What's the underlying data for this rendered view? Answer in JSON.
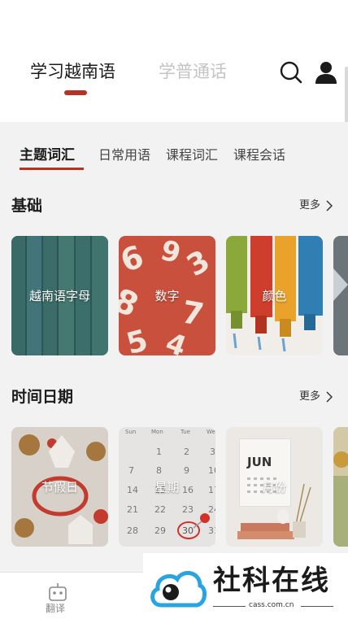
{
  "header": {
    "tabs": [
      {
        "label": "学习越南语",
        "active": true
      },
      {
        "label": "学普通话",
        "active": false
      }
    ],
    "icons": [
      "search-icon",
      "user-icon"
    ],
    "accent_color": "#b8321f"
  },
  "sub_tabs": [
    {
      "label": "主题词汇",
      "active": true
    },
    {
      "label": "日常用语",
      "active": false
    },
    {
      "label": "课程词汇",
      "active": false
    },
    {
      "label": "课程会话",
      "active": false
    }
  ],
  "sections": [
    {
      "title": "基础",
      "more_label": "更多",
      "cards": [
        {
          "label": "越南语字母"
        },
        {
          "label": "数字"
        },
        {
          "label": "颜色"
        },
        {
          "label": ""
        }
      ]
    },
    {
      "title": "时间日期",
      "more_label": "更多",
      "cards": [
        {
          "label": "节假日"
        },
        {
          "label": "星期"
        },
        {
          "label": "月份"
        },
        {
          "label": ""
        }
      ]
    }
  ],
  "calendar_art": {
    "weekdays": [
      "Sun",
      "Mon",
      "Tue",
      "We"
    ],
    "rows": [
      [
        "",
        "1",
        "2",
        "3"
      ],
      [
        "7",
        "8",
        "9",
        "10"
      ],
      [
        "14",
        "15",
        "16",
        "17"
      ],
      [
        "21",
        "22",
        "23",
        "24"
      ],
      [
        "28",
        "29",
        "30",
        "31"
      ]
    ]
  },
  "month_art": {
    "text": "JUN"
  },
  "bottom_nav": {
    "items": [
      {
        "label": "翻译",
        "icon": "robot-icon"
      }
    ]
  },
  "watermark": {
    "brand": "社科在线",
    "domain": "cass.com.cn"
  }
}
